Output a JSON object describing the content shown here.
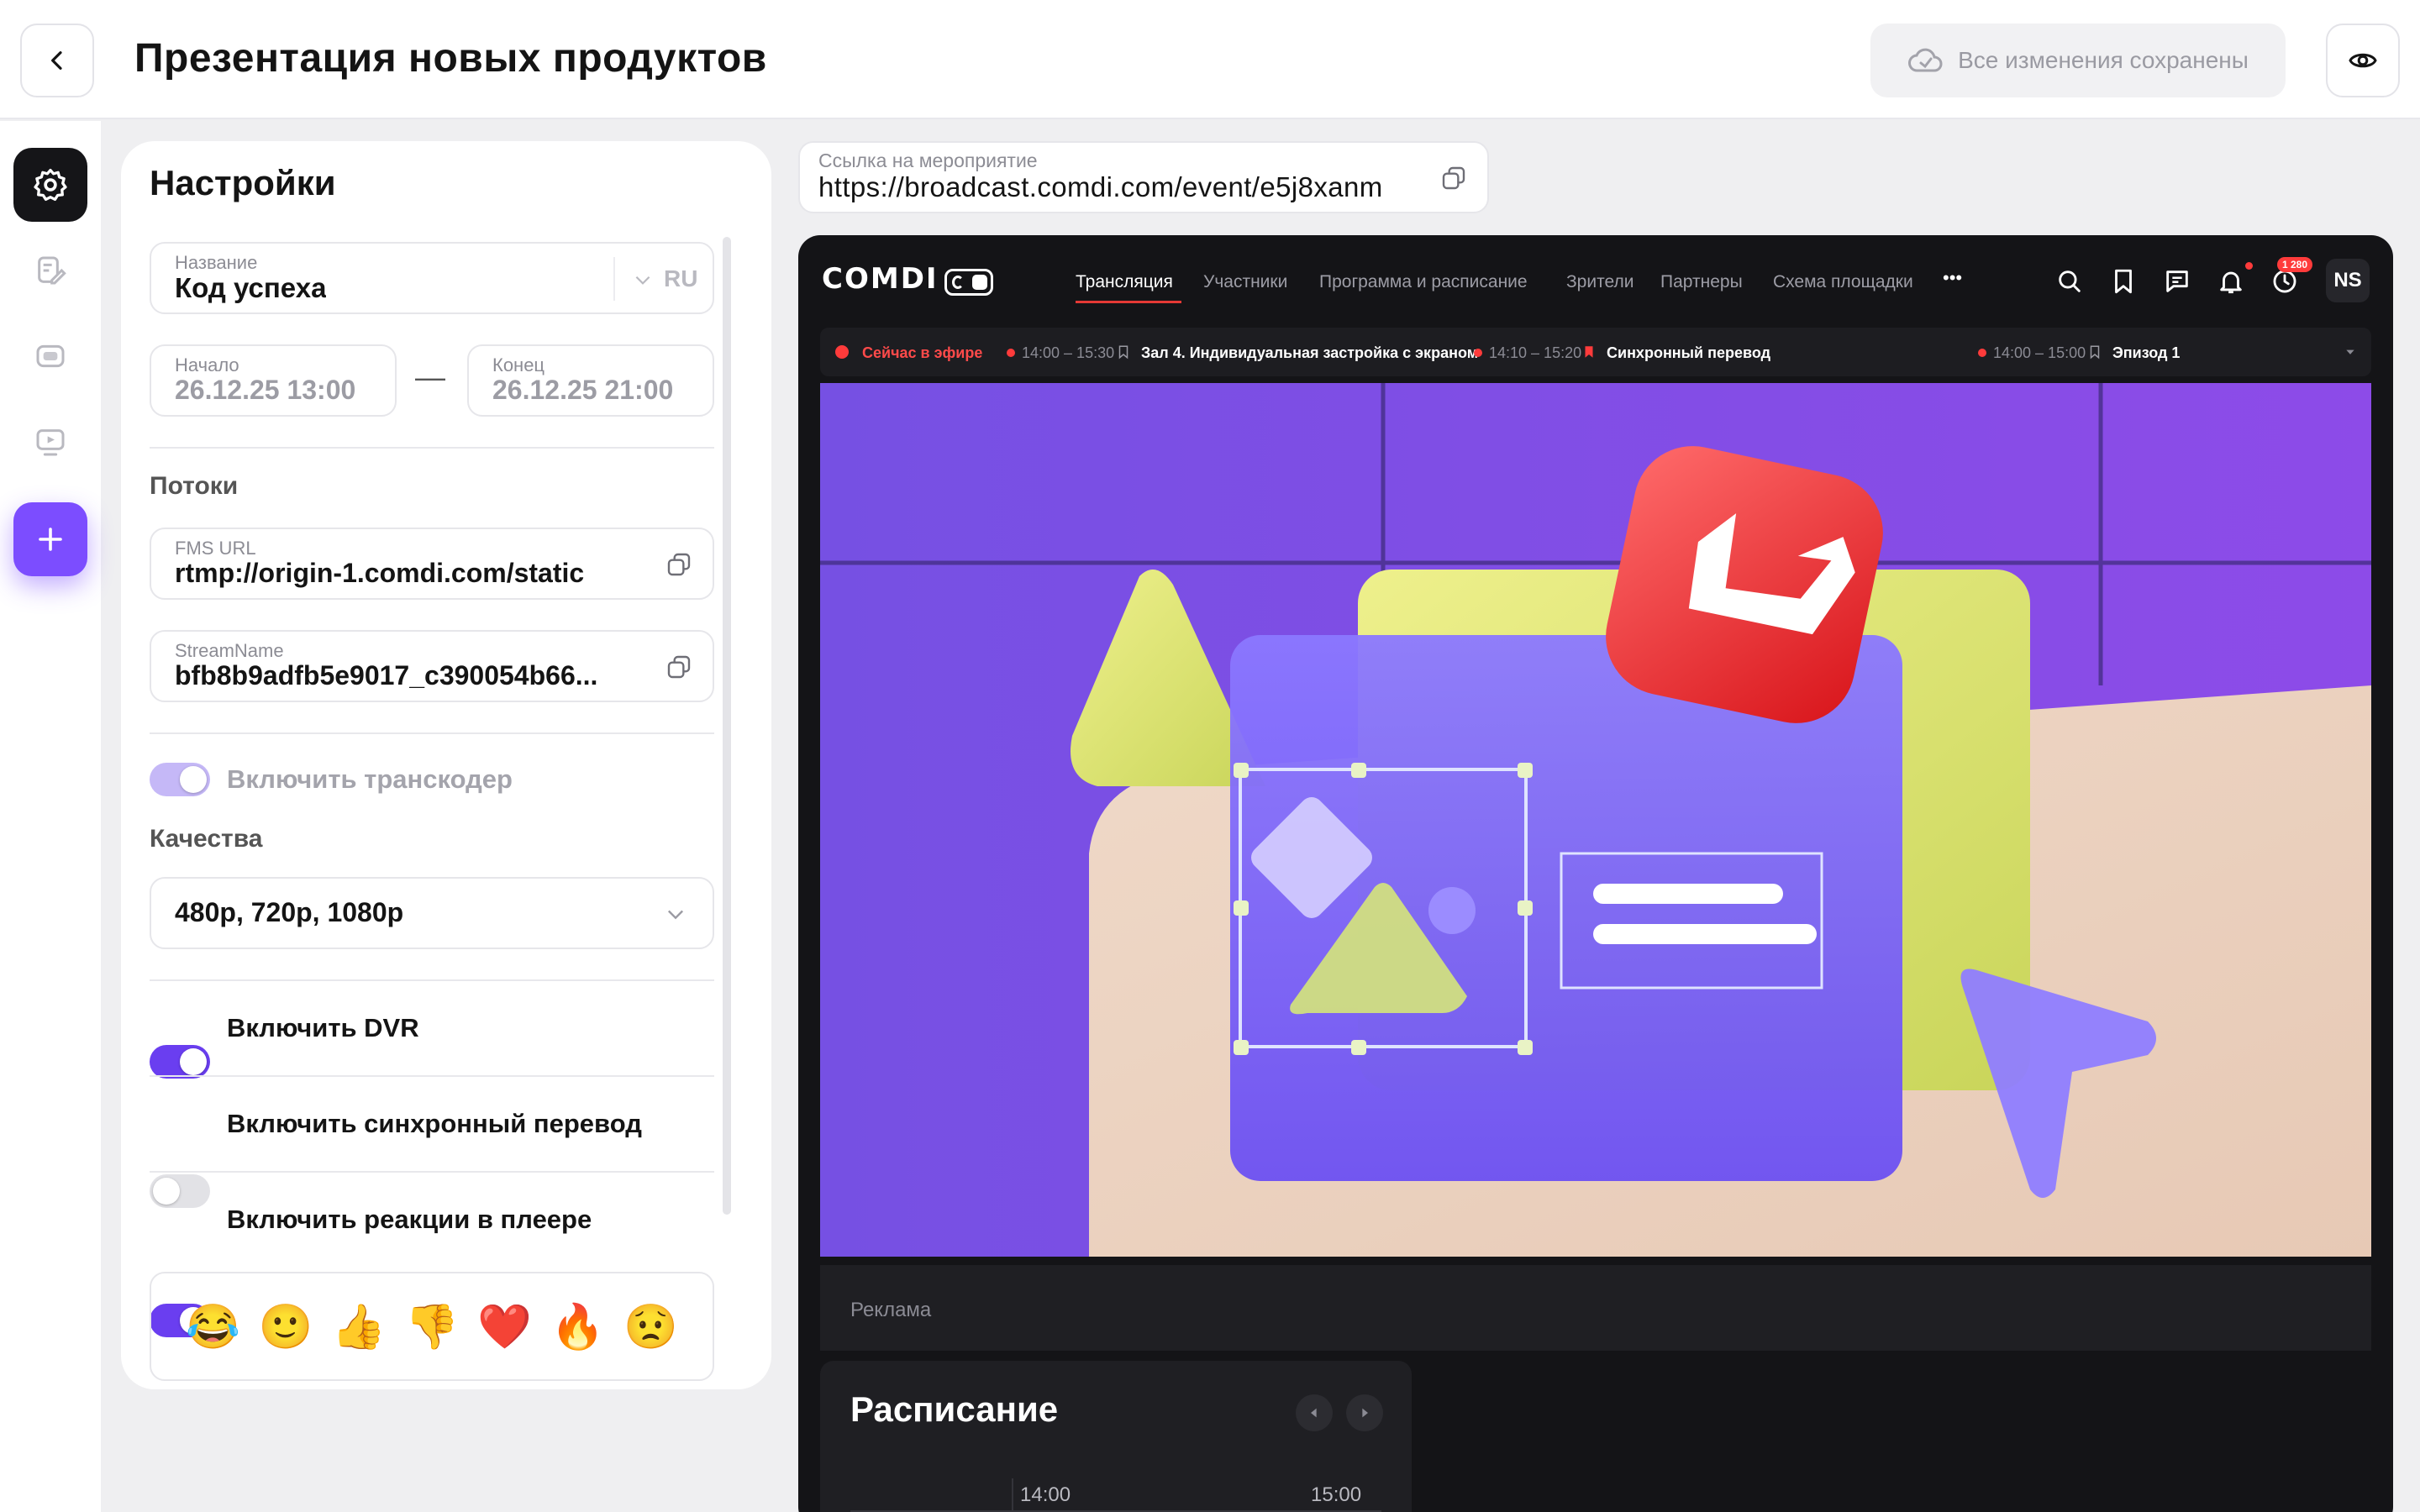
{
  "header": {
    "title": "Презентация новых продуктов",
    "save_status": "Все изменения сохранены"
  },
  "icons": {
    "back": "chevron-left-icon",
    "cloud": "cloud-check-icon",
    "preview": "eye-icon",
    "rail": [
      "gear-icon",
      "edit-document-icon",
      "screen-icon",
      "video-play-icon",
      "plus-icon"
    ]
  },
  "colors": {
    "accent": "#7c4dff",
    "toggle_on": "#6a3ef0",
    "live_red": "#ff3b3b",
    "player_bg": "#141417"
  },
  "settings": {
    "title": "Настройки",
    "name_label": "Название",
    "name_value": "Код успеха",
    "lang": "RU",
    "start_label": "Начало",
    "start_value": "26.12.25 13:00",
    "dash": "—",
    "end_label": "Конец",
    "end_value": "26.12.25 21:00",
    "streams_section": "Потоки",
    "fms_label": "FMS URL",
    "fms_value": "rtmp://origin-1.comdi.com/static",
    "stream_label": "StreamName",
    "stream_value": "bfb8b9adfb5e9017_c390054b66...",
    "transcoder_label": "Включить транскодер",
    "quality_section": "Качества",
    "quality_value": "480p, 720p, 1080p",
    "dvr_label": "Включить DVR",
    "sync_label": "Включить синхронный перевод",
    "reactions_label": "Включить реакции в плеере",
    "emojis": [
      "😂",
      "🙂",
      "👍",
      "👎",
      "❤️",
      "🔥",
      "😟"
    ]
  },
  "toggles": {
    "transcoder": true,
    "dvr": true,
    "sync": false,
    "reactions": true
  },
  "event_link": {
    "label": "Ссылка на мероприятие",
    "value": "https://broadcast.comdi.com/event/e5j8xanm"
  },
  "player": {
    "logo": "COMDI",
    "nav": [
      "Трансляция",
      "Участники",
      "Программа и расписание",
      "Зрители",
      "Партнеры",
      "Схема площадки"
    ],
    "more": "•••",
    "badge": "1 280",
    "avatar": "NS",
    "ticker": {
      "live": "Сейчас в эфире",
      "t1": "14:00 – 15:30",
      "s1": "Зал 4. Индивидуальная застройка с экраном",
      "t2": "14:10 – 15:20",
      "s2": "Синхронный перевод",
      "t3": "14:00 – 15:00",
      "s3": "Эпизод 1"
    },
    "ad_label": "Реклама",
    "schedule_title": "Расписание",
    "times": [
      "14:00",
      "15:00"
    ]
  }
}
